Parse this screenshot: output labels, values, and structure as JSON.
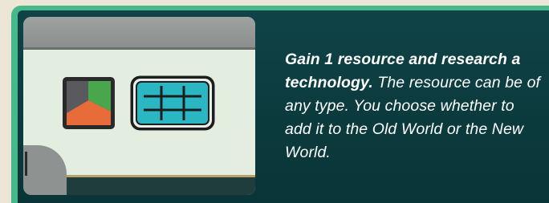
{
  "rule": {
    "bold_text": "Gain 1 resource and research a technology.",
    "body_text": " The resource can be of any type. You choose whether to add it to the Old World or the New World."
  },
  "icons": {
    "resource": "any-resource-icon",
    "technology": "technology-grid-icon"
  },
  "colors": {
    "panel_bg": "#0c3b3e",
    "frame_green": "#46b889",
    "card_bg": "#e0ebdc",
    "resource_green": "#4aa64c",
    "resource_orange": "#e86c3a",
    "resource_gray": "#5a5a5e",
    "tech_cyan": "#2bb6c4"
  }
}
